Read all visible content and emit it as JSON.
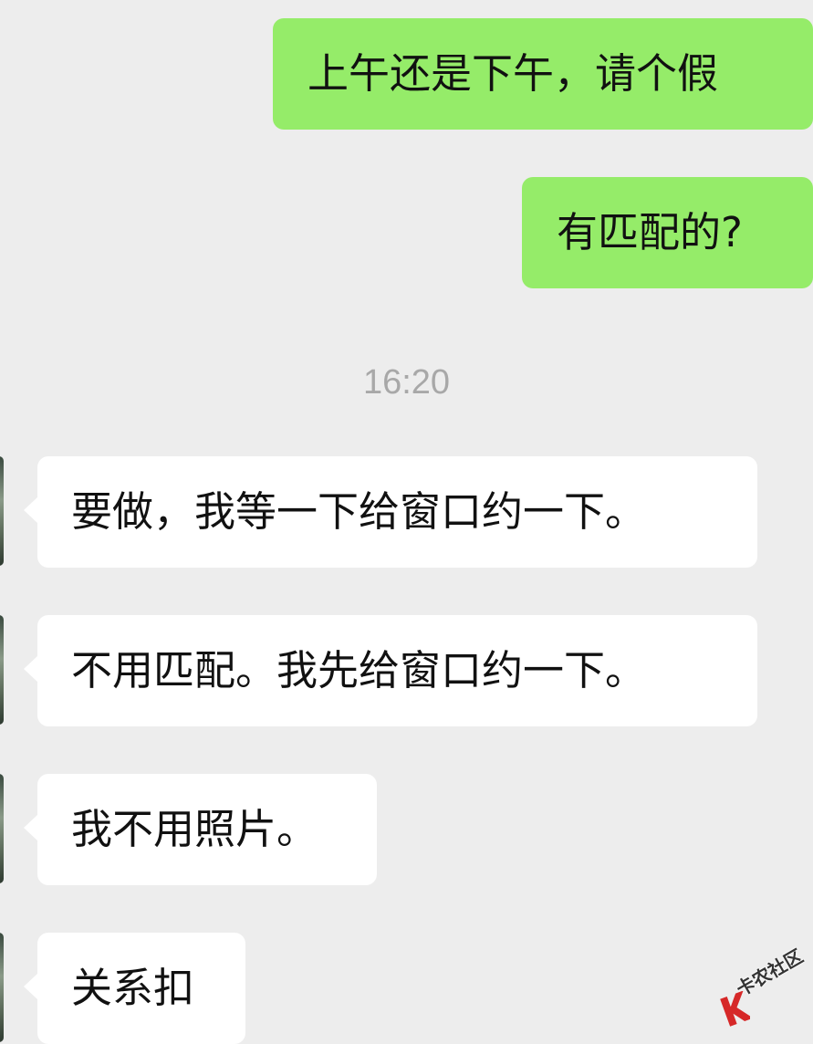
{
  "messages": [
    {
      "direction": "outgoing",
      "text": "上午还是下午，请个假"
    },
    {
      "direction": "outgoing",
      "text": "有匹配的?"
    },
    {
      "direction": "incoming",
      "text": "要做，我等一下给窗口约一下。"
    },
    {
      "direction": "incoming",
      "text": "不用匹配。我先给窗口约一下。"
    },
    {
      "direction": "incoming",
      "text": "我不用照片。"
    },
    {
      "direction": "incoming",
      "text": "关系扣"
    }
  ],
  "timestamp": "16:20",
  "watermark": "卡农社区",
  "colors": {
    "background": "#ededed",
    "outgoing_bubble": "#95ec69",
    "incoming_bubble": "#ffffff",
    "timestamp_text": "#a8a8a8",
    "watermark_accent": "#d62828"
  }
}
